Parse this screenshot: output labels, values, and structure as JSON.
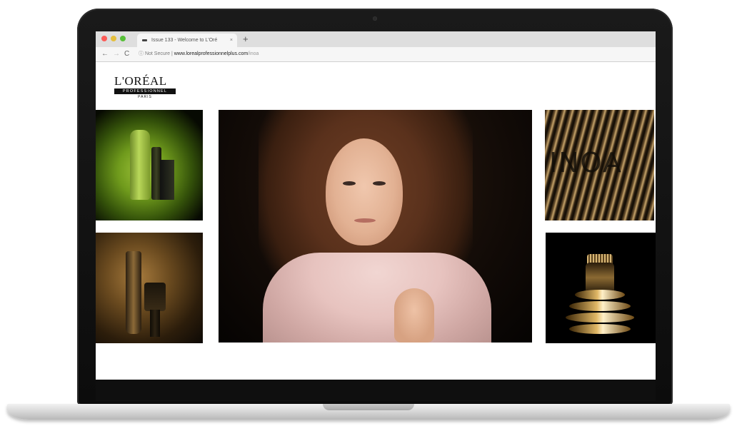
{
  "browser": {
    "tab_title": "Issue 133 - Welcome to L'Oré",
    "tab_close": "×",
    "new_tab": "+",
    "nav_back": "←",
    "nav_forward": "→",
    "nav_reload": "C",
    "security_label": "Not Secure",
    "url_host": "www.lorealprofessionnelplus.com",
    "url_path": "/inoa"
  },
  "logo": {
    "main": "L'ORÉAL",
    "sub": "PROFESSIONNEL",
    "paris": "PARIS"
  },
  "tiles": {
    "inoa_text": "INOA"
  },
  "colors": {
    "traffic_red": "#fc5b57",
    "traffic_yellow": "#e5bf3c",
    "traffic_green": "#57c038"
  }
}
